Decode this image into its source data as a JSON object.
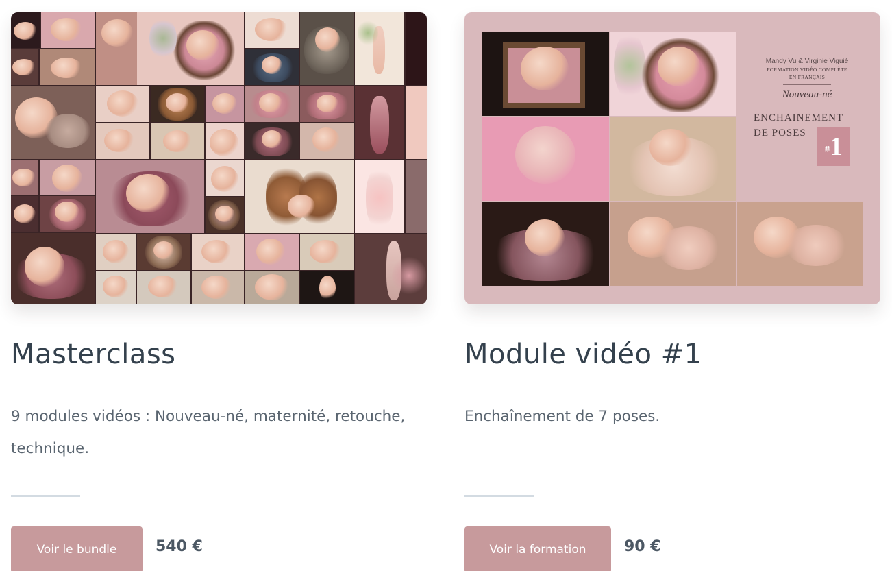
{
  "colors": {
    "button": "#c79a9c",
    "title": "#34414d",
    "body_text": "#5a6570",
    "divider": "#d3dbe2",
    "cover_background": "#d9b9bc",
    "badge": "#c98f98"
  },
  "products": [
    {
      "title": "Masterclass",
      "description": "9 modules vidéos : Nouveau-né, maternité, retouche, technique.",
      "button_label": "Voir le bundle",
      "price": "540 €"
    },
    {
      "title": "Module vidéo #1",
      "description": "Enchaînement de 7 poses.",
      "button_label": "Voir la formation",
      "price": "90 €",
      "cover": {
        "authors": "Mandy Vu & Virginie Viguié",
        "subtitle_line1": "FORMATION VIDÉO COMPLÈTE",
        "subtitle_line2": "EN FRANÇAIS",
        "category": "Nouveau-né",
        "title_line1": "ENCHAINEMENT",
        "title_line2": "DE POSES",
        "badge_hash": "#",
        "badge_number": "1"
      }
    }
  ]
}
